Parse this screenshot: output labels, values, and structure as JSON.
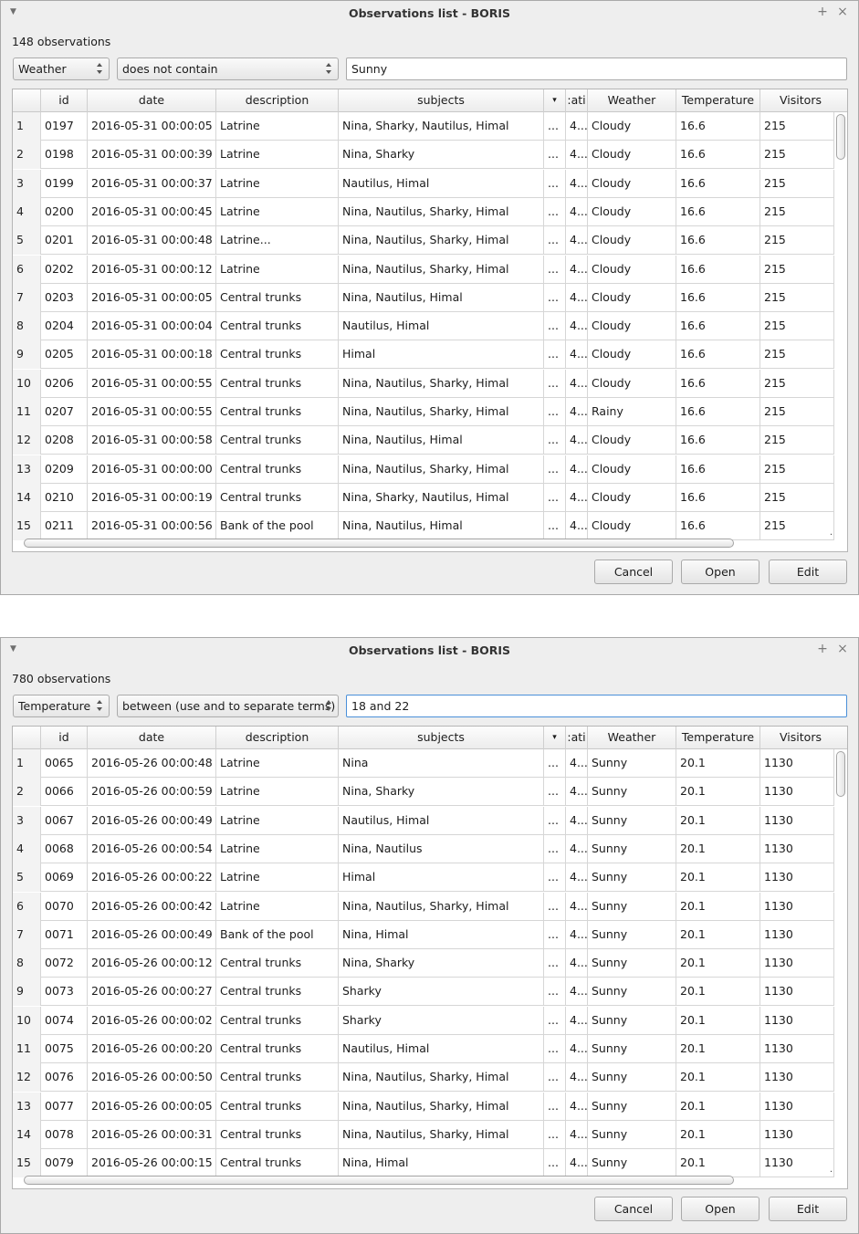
{
  "windows": [
    {
      "title": "Observations list - BORIS",
      "count_label": "148 observations",
      "filter": {
        "field": "Weather",
        "operator": "does not contain",
        "value": "Sunny"
      },
      "columns": [
        "id",
        "date",
        "description",
        "subjects",
        "▾",
        ":ati",
        "Weather",
        "Temperature",
        "Visitors"
      ],
      "rows": [
        {
          "n": "1",
          "id": "0197",
          "date": "2016-05-31 00:00:05",
          "description": "Latrine",
          "subjects": "Nina, Sharky, Nautilus, Himal",
          "more": "...",
          "loc": "4...",
          "weather": "Cloudy",
          "temperature": "16.6",
          "visitors": "215"
        },
        {
          "n": "2",
          "id": "0198",
          "date": "2016-05-31 00:00:39",
          "description": "Latrine",
          "subjects": "Nina, Sharky",
          "more": "...",
          "loc": "4...",
          "weather": "Cloudy",
          "temperature": "16.6",
          "visitors": "215"
        },
        {
          "n": "3",
          "id": "0199",
          "date": "2016-05-31 00:00:37",
          "description": "Latrine",
          "subjects": "Nautilus, Himal",
          "more": "...",
          "loc": "4...",
          "weather": "Cloudy",
          "temperature": "16.6",
          "visitors": "215"
        },
        {
          "n": "4",
          "id": "0200",
          "date": "2016-05-31 00:00:45",
          "description": "Latrine",
          "subjects": "Nina, Nautilus, Sharky, Himal",
          "more": "...",
          "loc": "4...",
          "weather": "Cloudy",
          "temperature": "16.6",
          "visitors": "215"
        },
        {
          "n": "5",
          "id": "0201",
          "date": "2016-05-31 00:00:48",
          "description": "Latrine...",
          "subjects": "Nina, Nautilus, Sharky, Himal",
          "more": "...",
          "loc": "4...",
          "weather": "Cloudy",
          "temperature": "16.6",
          "visitors": "215"
        },
        {
          "n": "6",
          "id": "0202",
          "date": "2016-05-31 00:00:12",
          "description": "Latrine",
          "subjects": "Nina, Nautilus, Sharky, Himal",
          "more": "...",
          "loc": "4...",
          "weather": "Cloudy",
          "temperature": "16.6",
          "visitors": "215"
        },
        {
          "n": "7",
          "id": "0203",
          "date": "2016-05-31 00:00:05",
          "description": "Central trunks",
          "subjects": "Nina, Nautilus, Himal",
          "more": "...",
          "loc": "4...",
          "weather": "Cloudy",
          "temperature": "16.6",
          "visitors": "215"
        },
        {
          "n": "8",
          "id": "0204",
          "date": "2016-05-31 00:00:04",
          "description": "Central trunks",
          "subjects": "Nautilus, Himal",
          "more": "...",
          "loc": "4...",
          "weather": "Cloudy",
          "temperature": "16.6",
          "visitors": "215"
        },
        {
          "n": "9",
          "id": "0205",
          "date": "2016-05-31 00:00:18",
          "description": "Central trunks",
          "subjects": "Himal",
          "more": "...",
          "loc": "4...",
          "weather": "Cloudy",
          "temperature": "16.6",
          "visitors": "215"
        },
        {
          "n": "10",
          "id": "0206",
          "date": "2016-05-31 00:00:55",
          "description": "Central trunks",
          "subjects": "Nina, Nautilus, Sharky, Himal",
          "more": "...",
          "loc": "4...",
          "weather": "Cloudy",
          "temperature": "16.6",
          "visitors": "215"
        },
        {
          "n": "11",
          "id": "0207",
          "date": "2016-05-31 00:00:55",
          "description": "Central trunks",
          "subjects": "Nina, Nautilus, Sharky, Himal",
          "more": "...",
          "loc": "4...",
          "weather": "Rainy",
          "temperature": "16.6",
          "visitors": "215"
        },
        {
          "n": "12",
          "id": "0208",
          "date": "2016-05-31 00:00:58",
          "description": "Central trunks",
          "subjects": "Nina, Nautilus, Himal",
          "more": "...",
          "loc": "4...",
          "weather": "Cloudy",
          "temperature": "16.6",
          "visitors": "215"
        },
        {
          "n": "13",
          "id": "0209",
          "date": "2016-05-31 00:00:00",
          "description": "Central trunks",
          "subjects": "Nina, Nautilus, Sharky, Himal",
          "more": "...",
          "loc": "4...",
          "weather": "Cloudy",
          "temperature": "16.6",
          "visitors": "215"
        },
        {
          "n": "14",
          "id": "0210",
          "date": "2016-05-31 00:00:19",
          "description": "Central trunks",
          "subjects": "Nina, Sharky, Nautilus, Himal",
          "more": "...",
          "loc": "4...",
          "weather": "Cloudy",
          "temperature": "16.6",
          "visitors": "215"
        },
        {
          "n": "15",
          "id": "0211",
          "date": "2016-05-31 00:00:56",
          "description": "Bank of the pool",
          "subjects": "Nina, Nautilus, Himal",
          "more": "...",
          "loc": "4...",
          "weather": "Cloudy",
          "temperature": "16.6",
          "visitors": "215"
        }
      ],
      "buttons": {
        "cancel": "Cancel",
        "open": "Open",
        "edit": "Edit"
      }
    },
    {
      "title": "Observations list - BORIS",
      "count_label": "780 observations",
      "filter": {
        "field": "Temperature",
        "operator": "between (use and to separate terms)",
        "value": "18 and 22"
      },
      "columns": [
        "id",
        "date",
        "description",
        "subjects",
        "▾",
        ":ati",
        "Weather",
        "Temperature",
        "Visitors"
      ],
      "rows": [
        {
          "n": "1",
          "id": "0065",
          "date": "2016-05-26 00:00:48",
          "description": "Latrine",
          "subjects": "Nina",
          "more": "...",
          "loc": "4...",
          "weather": "Sunny",
          "temperature": "20.1",
          "visitors": "1130"
        },
        {
          "n": "2",
          "id": "0066",
          "date": "2016-05-26 00:00:59",
          "description": "Latrine",
          "subjects": "Nina, Sharky",
          "more": "...",
          "loc": "4...",
          "weather": "Sunny",
          "temperature": "20.1",
          "visitors": "1130"
        },
        {
          "n": "3",
          "id": "0067",
          "date": "2016-05-26 00:00:49",
          "description": "Latrine",
          "subjects": "Nautilus, Himal",
          "more": "...",
          "loc": "4...",
          "weather": "Sunny",
          "temperature": "20.1",
          "visitors": "1130"
        },
        {
          "n": "4",
          "id": "0068",
          "date": "2016-05-26 00:00:54",
          "description": "Latrine",
          "subjects": "Nina, Nautilus",
          "more": "...",
          "loc": "4...",
          "weather": "Sunny",
          "temperature": "20.1",
          "visitors": "1130"
        },
        {
          "n": "5",
          "id": "0069",
          "date": "2016-05-26 00:00:22",
          "description": "Latrine",
          "subjects": "Himal",
          "more": "...",
          "loc": "4...",
          "weather": "Sunny",
          "temperature": "20.1",
          "visitors": "1130"
        },
        {
          "n": "6",
          "id": "0070",
          "date": "2016-05-26 00:00:42",
          "description": "Latrine",
          "subjects": "Nina, Nautilus, Sharky, Himal",
          "more": "...",
          "loc": "4...",
          "weather": "Sunny",
          "temperature": "20.1",
          "visitors": "1130"
        },
        {
          "n": "7",
          "id": "0071",
          "date": "2016-05-26 00:00:49",
          "description": "Bank of the pool",
          "subjects": "Nina, Himal",
          "more": "...",
          "loc": "4...",
          "weather": "Sunny",
          "temperature": "20.1",
          "visitors": "1130"
        },
        {
          "n": "8",
          "id": "0072",
          "date": "2016-05-26 00:00:12",
          "description": "Central trunks",
          "subjects": "Nina, Sharky",
          "more": "...",
          "loc": "4...",
          "weather": "Sunny",
          "temperature": "20.1",
          "visitors": "1130"
        },
        {
          "n": "9",
          "id": "0073",
          "date": "2016-05-26 00:00:27",
          "description": "Central trunks",
          "subjects": "Sharky",
          "more": "...",
          "loc": "4...",
          "weather": "Sunny",
          "temperature": "20.1",
          "visitors": "1130"
        },
        {
          "n": "10",
          "id": "0074",
          "date": "2016-05-26 00:00:02",
          "description": "Central trunks",
          "subjects": "Sharky",
          "more": "...",
          "loc": "4...",
          "weather": "Sunny",
          "temperature": "20.1",
          "visitors": "1130"
        },
        {
          "n": "11",
          "id": "0075",
          "date": "2016-05-26 00:00:20",
          "description": "Central trunks",
          "subjects": "Nautilus, Himal",
          "more": "...",
          "loc": "4...",
          "weather": "Sunny",
          "temperature": "20.1",
          "visitors": "1130"
        },
        {
          "n": "12",
          "id": "0076",
          "date": "2016-05-26 00:00:50",
          "description": "Central trunks",
          "subjects": "Nina, Nautilus, Sharky, Himal",
          "more": "...",
          "loc": "4...",
          "weather": "Sunny",
          "temperature": "20.1",
          "visitors": "1130"
        },
        {
          "n": "13",
          "id": "0077",
          "date": "2016-05-26 00:00:05",
          "description": "Central trunks",
          "subjects": "Nina, Nautilus, Sharky, Himal",
          "more": "...",
          "loc": "4...",
          "weather": "Sunny",
          "temperature": "20.1",
          "visitors": "1130"
        },
        {
          "n": "14",
          "id": "0078",
          "date": "2016-05-26 00:00:31",
          "description": "Central trunks",
          "subjects": "Nina, Nautilus, Sharky, Himal",
          "more": "...",
          "loc": "4...",
          "weather": "Sunny",
          "temperature": "20.1",
          "visitors": "1130"
        },
        {
          "n": "15",
          "id": "0079",
          "date": "2016-05-26 00:00:15",
          "description": "Central trunks",
          "subjects": "Nina, Himal",
          "more": "...",
          "loc": "4...",
          "weather": "Sunny",
          "temperature": "20.1",
          "visitors": "1130"
        }
      ],
      "buttons": {
        "cancel": "Cancel",
        "open": "Open",
        "edit": "Edit"
      }
    }
  ]
}
